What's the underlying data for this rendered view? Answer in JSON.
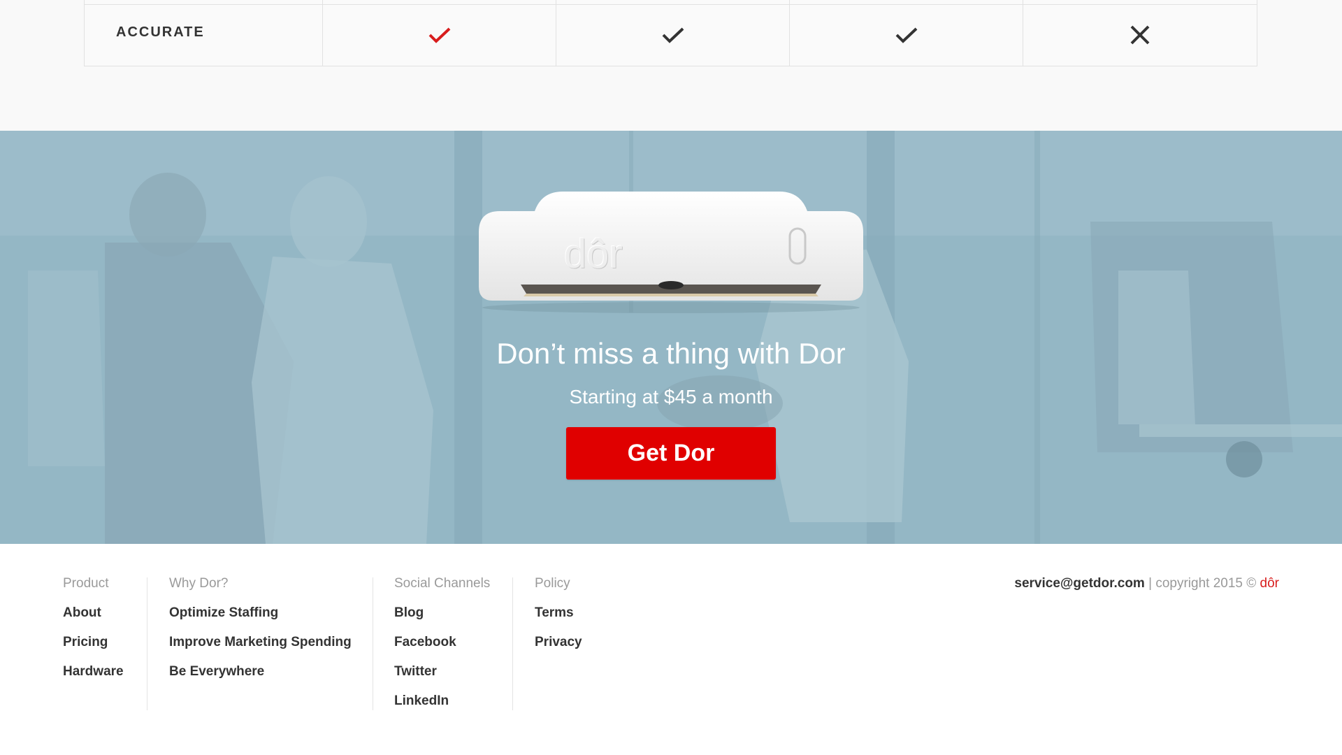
{
  "comparison": {
    "row_label": "ACCURATE",
    "marks": [
      {
        "type": "check",
        "color": "#d81d1d"
      },
      {
        "type": "check",
        "color": "#333333"
      },
      {
        "type": "check",
        "color": "#333333"
      },
      {
        "type": "cross",
        "color": "#333333"
      }
    ]
  },
  "hero": {
    "device_logo": "dôr",
    "title": "Don’t miss a thing with Dor",
    "subtitle": "Starting at $45 a month",
    "cta_label": "Get Dor",
    "cta_color": "#e00000",
    "overlay_color": "#94b7c5"
  },
  "footer": {
    "columns": [
      {
        "heading": "Product",
        "links": [
          "About",
          "Pricing",
          "Hardware"
        ]
      },
      {
        "heading": "Why Dor?",
        "links": [
          "Optimize Staffing",
          "Improve Marketing Spending",
          "Be Everywhere"
        ]
      },
      {
        "heading": "Social Channels",
        "links": [
          "Blog",
          "Facebook",
          "Twitter",
          "LinkedIn"
        ]
      },
      {
        "heading": "Policy",
        "links": [
          "Terms",
          "Privacy"
        ]
      }
    ],
    "email": "service@getdor.com",
    "copyright_text": " | copyright 2015 © ",
    "brand": "dôr",
    "brand_color": "#d81d1d"
  }
}
